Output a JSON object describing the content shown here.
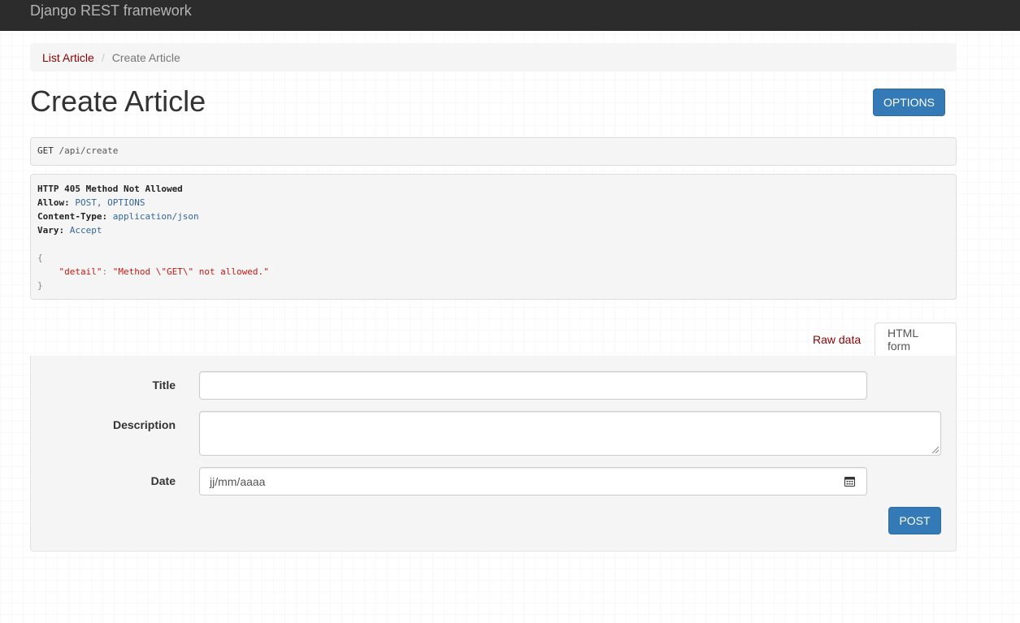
{
  "navbar": {
    "brand": "Django REST framework"
  },
  "breadcrumb": {
    "items": [
      {
        "label": "List Article"
      },
      {
        "label": "Create Article"
      }
    ],
    "separator": "/"
  },
  "page": {
    "title": "Create Article",
    "options_label": "OPTIONS"
  },
  "request": {
    "method": "GET",
    "path": "/api/create"
  },
  "response": {
    "status": "HTTP 405 Method Not Allowed",
    "headers": [
      {
        "name": "Allow:",
        "value": "POST, OPTIONS"
      },
      {
        "name": "Content-Type:",
        "value": "application/json"
      },
      {
        "name": "Vary:",
        "value": "Accept"
      }
    ],
    "body_open": "{",
    "body_key": "\"detail\"",
    "body_colon": ": ",
    "body_value": "\"Method \\\"GET\\\" not allowed.\"",
    "body_close": "}"
  },
  "tabs": {
    "raw": "Raw data",
    "html": "HTML form"
  },
  "form": {
    "title_label": "Title",
    "description_label": "Description",
    "date_label": "Date",
    "date_placeholder": "jj/mm/aaaa",
    "title_value": "",
    "description_value": "",
    "post_label": "POST"
  },
  "colors": {
    "navbar_bg": "#2c2c2c",
    "link": "#8b0000",
    "primary": "#337ab7",
    "meta": "#336699",
    "string": "#c41a16"
  }
}
